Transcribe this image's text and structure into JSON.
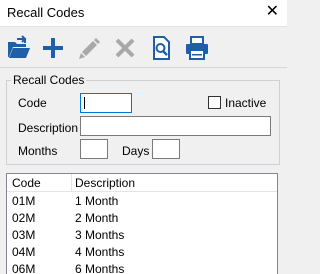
{
  "window": {
    "title": "Recall Codes",
    "close_glyph": "✕"
  },
  "toolbar": {
    "icons": [
      "open-folder-icon",
      "add-icon",
      "edit-icon",
      "delete-icon",
      "preview-icon",
      "print-icon"
    ]
  },
  "form": {
    "group_label": "Recall Codes",
    "code_label": "Code",
    "code_value": "",
    "inactive_label": "Inactive",
    "inactive_checked": false,
    "description_label": "Description",
    "description_value": "",
    "months_label": "Months",
    "months_value": "",
    "days_label": "Days",
    "days_value": ""
  },
  "table": {
    "columns": [
      "Code",
      "Description"
    ],
    "rows": [
      [
        "01M",
        "1 Month"
      ],
      [
        "02M",
        "2 Month"
      ],
      [
        "03M",
        "3 Months"
      ],
      [
        "04M",
        "4 Months"
      ],
      [
        "06M",
        "6 Months"
      ]
    ]
  },
  "colors": {
    "accent": "#0078d7",
    "icon_blue": "#1f5fa8",
    "icon_disabled": "#a8a8a8"
  }
}
